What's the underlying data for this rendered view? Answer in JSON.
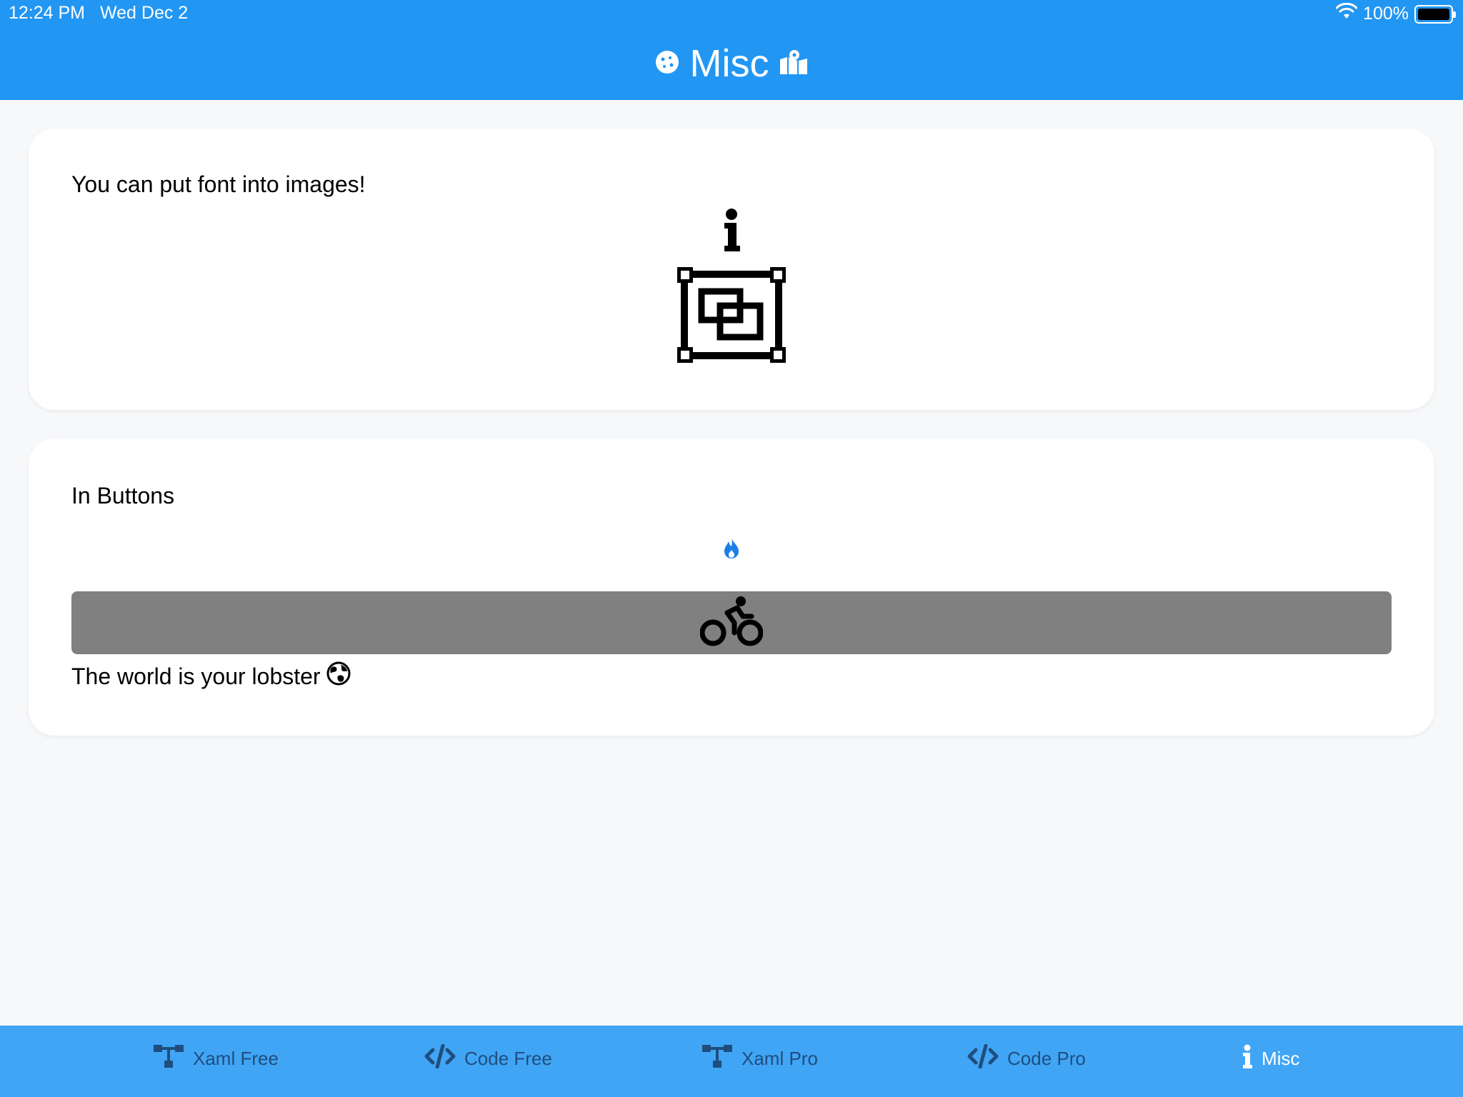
{
  "status": {
    "time": "12:24 PM",
    "date": "Wed Dec 2",
    "battery": "100%"
  },
  "header": {
    "title": "Misc"
  },
  "card1": {
    "text": "You can put font into images!"
  },
  "card2": {
    "heading": "In Buttons",
    "lobster": "The world is your lobster"
  },
  "tabs": [
    {
      "label": "Xaml Free",
      "icon": "sitemap-icon",
      "active": false
    },
    {
      "label": "Code Free",
      "icon": "code-icon",
      "active": false
    },
    {
      "label": "Xaml Pro",
      "icon": "sitemap-icon",
      "active": false
    },
    {
      "label": "Code Pro",
      "icon": "code-icon",
      "active": false
    },
    {
      "label": "Misc",
      "icon": "info-icon",
      "active": true
    }
  ],
  "colors": {
    "header": "#2296f3",
    "tabbar": "#41a5f5",
    "tab_inactive": "#1e4e7e",
    "tab_active": "#ffffff",
    "button_bg": "#808080",
    "fire_icon": "#1a7fe6"
  }
}
